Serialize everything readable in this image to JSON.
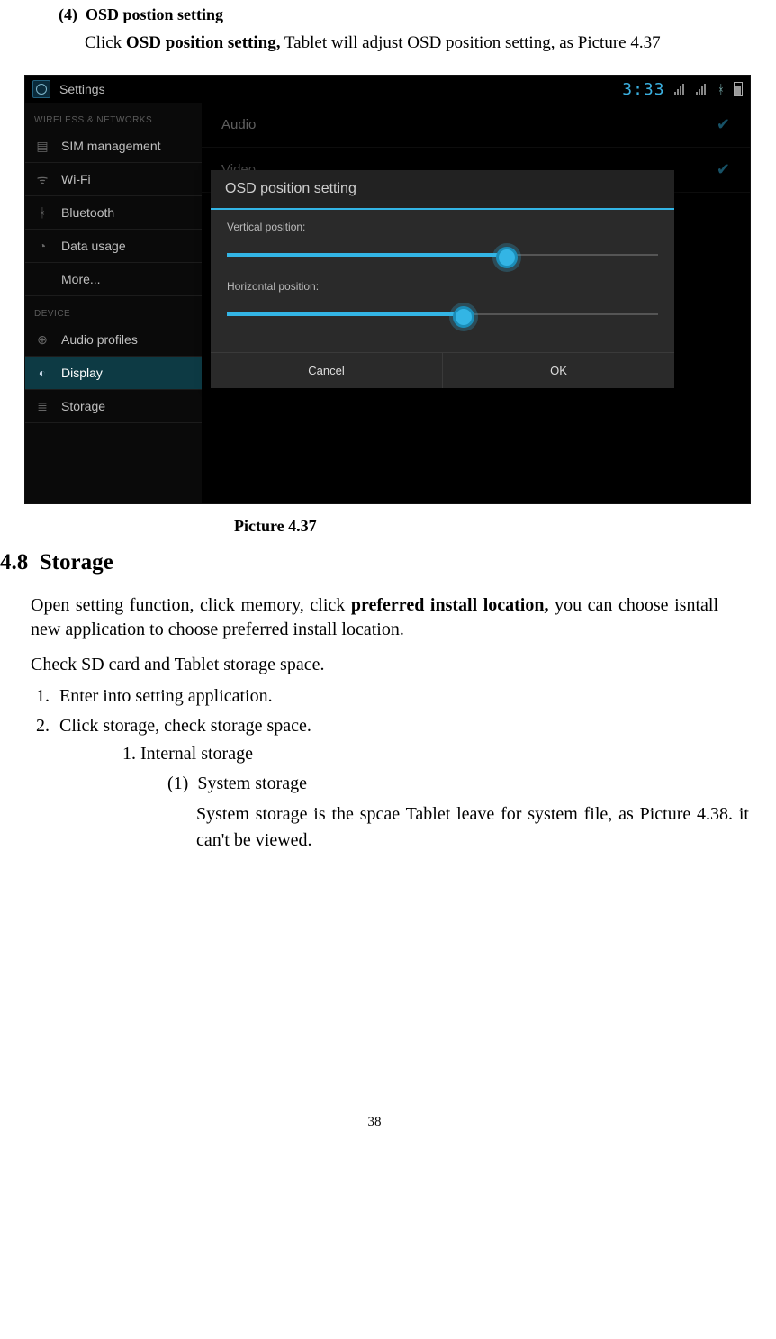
{
  "section_item": {
    "number": "(4)",
    "title": "OSD postion setting"
  },
  "click_sentence": {
    "prefix": "Click ",
    "bold": "OSD position setting,",
    "suffix": " Tablet will adjust OSD position setting, as Picture 4.37"
  },
  "shot": {
    "statusbar": {
      "settings_label": "Settings",
      "time": "3:33",
      "bt_glyph": "ᚼ"
    },
    "sidebar": {
      "cat1": "WIRELESS & NETWORKS",
      "items1": [
        "SIM management",
        "Wi-Fi",
        "Bluetooth",
        "Data usage",
        "More..."
      ],
      "cat2": "DEVICE",
      "items2": [
        "Audio profiles",
        "Display",
        "Storage"
      ]
    },
    "content": {
      "row_audio": "Audio",
      "row_video": "Video"
    },
    "dialog": {
      "title": "OSD position setting",
      "vlabel": "Vertical position:",
      "hlabel": "Horizontal position:",
      "v_pct": 65,
      "h_pct": 55,
      "cancel": "Cancel",
      "ok": "OK"
    }
  },
  "caption": "Picture 4.37",
  "storage_heading": {
    "num": "4.8",
    "title": "Storage"
  },
  "storage_para": {
    "a": "Open setting function, click memory, click ",
    "b": "preferred install location,",
    "c": " you can choose isntall new application to choose preferred install location."
  },
  "check_sentence": "Check SD card and Tablet storage space.",
  "numlist": [
    "Enter into setting application.",
    "Click storage, check storage space."
  ],
  "inner_list": [
    "Internal storage"
  ],
  "paren": {
    "label": "(1)",
    "title": "System storage",
    "body": "System storage is the spcae Tablet leave for system file, as Picture 4.38. it can't be viewed."
  },
  "page_number": "38"
}
